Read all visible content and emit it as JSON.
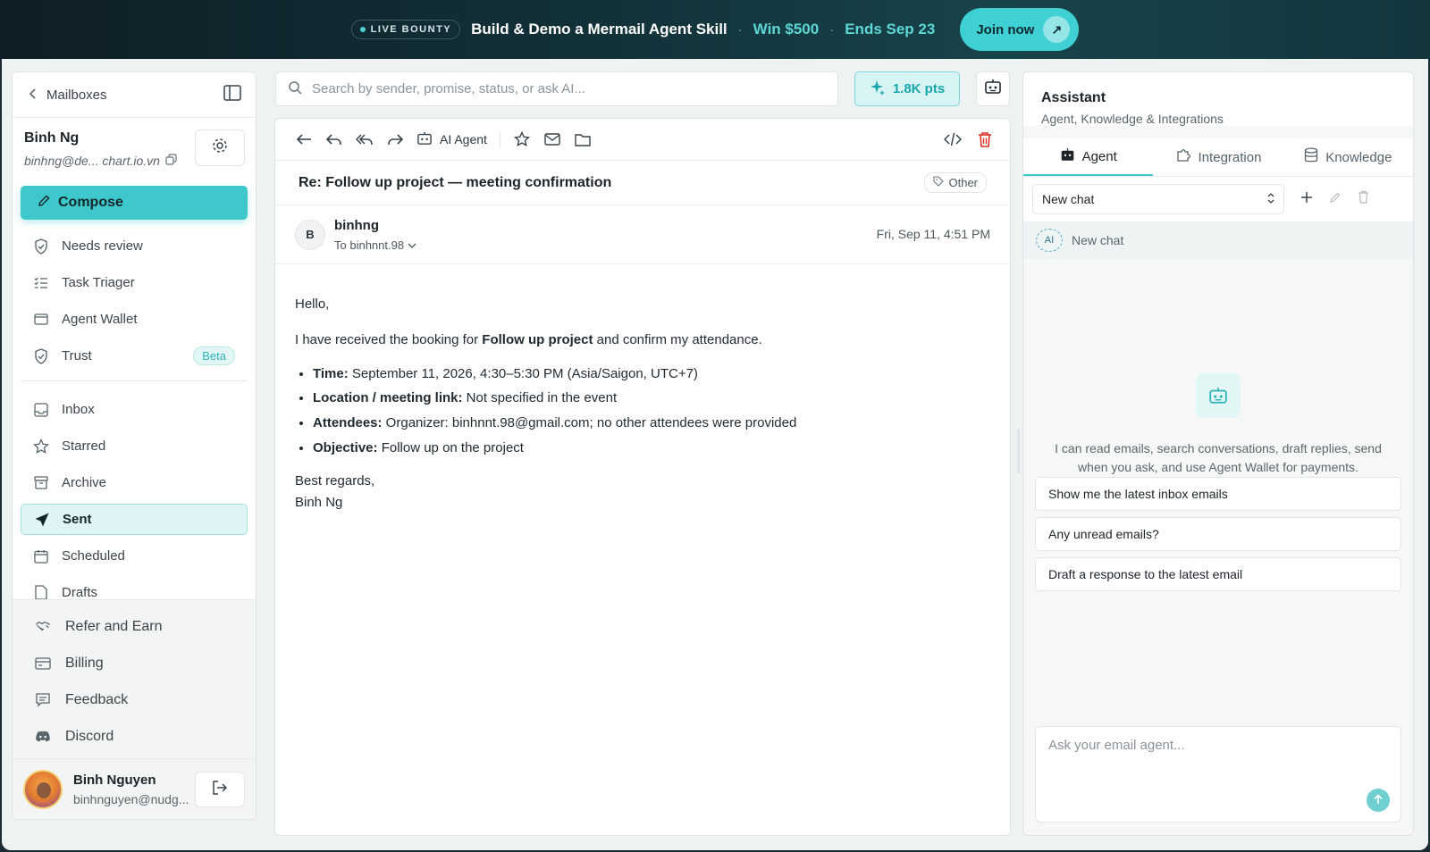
{
  "banner": {
    "live_label": "LIVE BOUNTY",
    "title": "Build & Demo a Mermail Agent Skill",
    "sep1": "·",
    "prize": "Win $500",
    "sep2": "·",
    "deadline": "Ends Sep 23",
    "cta": "Join now"
  },
  "sidebar": {
    "back_label": "Mailboxes",
    "account_name": "Binh Ng",
    "account_email": "binhng@de... chart.io.vn",
    "compose_label": "Compose",
    "tools": [
      {
        "label": "Needs review",
        "icon": "shield-check-icon"
      },
      {
        "label": "Task Triager",
        "icon": "list-check-icon"
      },
      {
        "label": "Agent Wallet",
        "icon": "wallet-icon"
      },
      {
        "label": "Trust",
        "icon": "shield-check-icon",
        "badge": "Beta"
      }
    ],
    "folders": [
      {
        "label": "Inbox",
        "icon": "inbox-icon"
      },
      {
        "label": "Starred",
        "icon": "star-icon"
      },
      {
        "label": "Archive",
        "icon": "archive-icon"
      },
      {
        "label": "Sent",
        "icon": "send-icon",
        "active": true
      },
      {
        "label": "Scheduled",
        "icon": "calendar-icon"
      },
      {
        "label": "Drafts",
        "icon": "draft-icon"
      }
    ],
    "footer": [
      {
        "label": "Refer and Earn",
        "icon": "handshake-icon"
      },
      {
        "label": "Billing",
        "icon": "card-icon"
      },
      {
        "label": "Feedback",
        "icon": "feedback-icon"
      },
      {
        "label": "Discord",
        "icon": "discord-icon"
      }
    ],
    "user_name": "Binh Nguyen",
    "user_email": "binhnguyen@nudg..."
  },
  "search": {
    "placeholder": "Search by sender, promise, status, or ask AI...",
    "points": "1.8K pts"
  },
  "email": {
    "ai_agent_label": "AI Agent",
    "subject": "Re: Follow up project — meeting confirmation",
    "tag": "Other",
    "sender_initial": "B",
    "sender_name": "binhng",
    "to_line": "To binhnnt.98",
    "date": "Fri, Sep 11, 4:51 PM",
    "greeting": "Hello,",
    "intro_pre": "I have received the booking for ",
    "intro_bold": "Follow up project",
    "intro_post": " and confirm my attendance.",
    "details": [
      {
        "key": "Time:",
        "value": " September 11, 2026, 4:30–5:30 PM (Asia/Saigon, UTC+7)"
      },
      {
        "key": "Location / meeting link:",
        "value": " Not specified in the event"
      },
      {
        "key": "Attendees:",
        "value": " Organizer: binhnnt.98@gmail.com; no other attendees were provided"
      },
      {
        "key": "Objective:",
        "value": " Follow up on the project"
      }
    ],
    "signoff": "Best regards,",
    "signature": "Binh Ng"
  },
  "assistant": {
    "title": "Assistant",
    "subtitle": "Agent, Knowledge & Integrations",
    "tabs": [
      {
        "label": "Agent",
        "icon": "robot-icon",
        "active": true
      },
      {
        "label": "Integration",
        "icon": "puzzle-icon"
      },
      {
        "label": "Knowledge",
        "icon": "database-icon"
      }
    ],
    "chat_select": "New chat",
    "chat_item_badge": "AI",
    "chat_item_label": "New chat",
    "description": "I can read emails, search conversations, draft replies, send when you ask, and use Agent Wallet for payments.",
    "suggestions": [
      "Show me the latest inbox emails",
      "Any unread emails?",
      "Draft a response to the latest email"
    ],
    "composer_placeholder": "Ask your email agent..."
  },
  "colors": {
    "accent": "#3fc8cc",
    "banner_bg": "#123038",
    "danger": "#d93025"
  }
}
